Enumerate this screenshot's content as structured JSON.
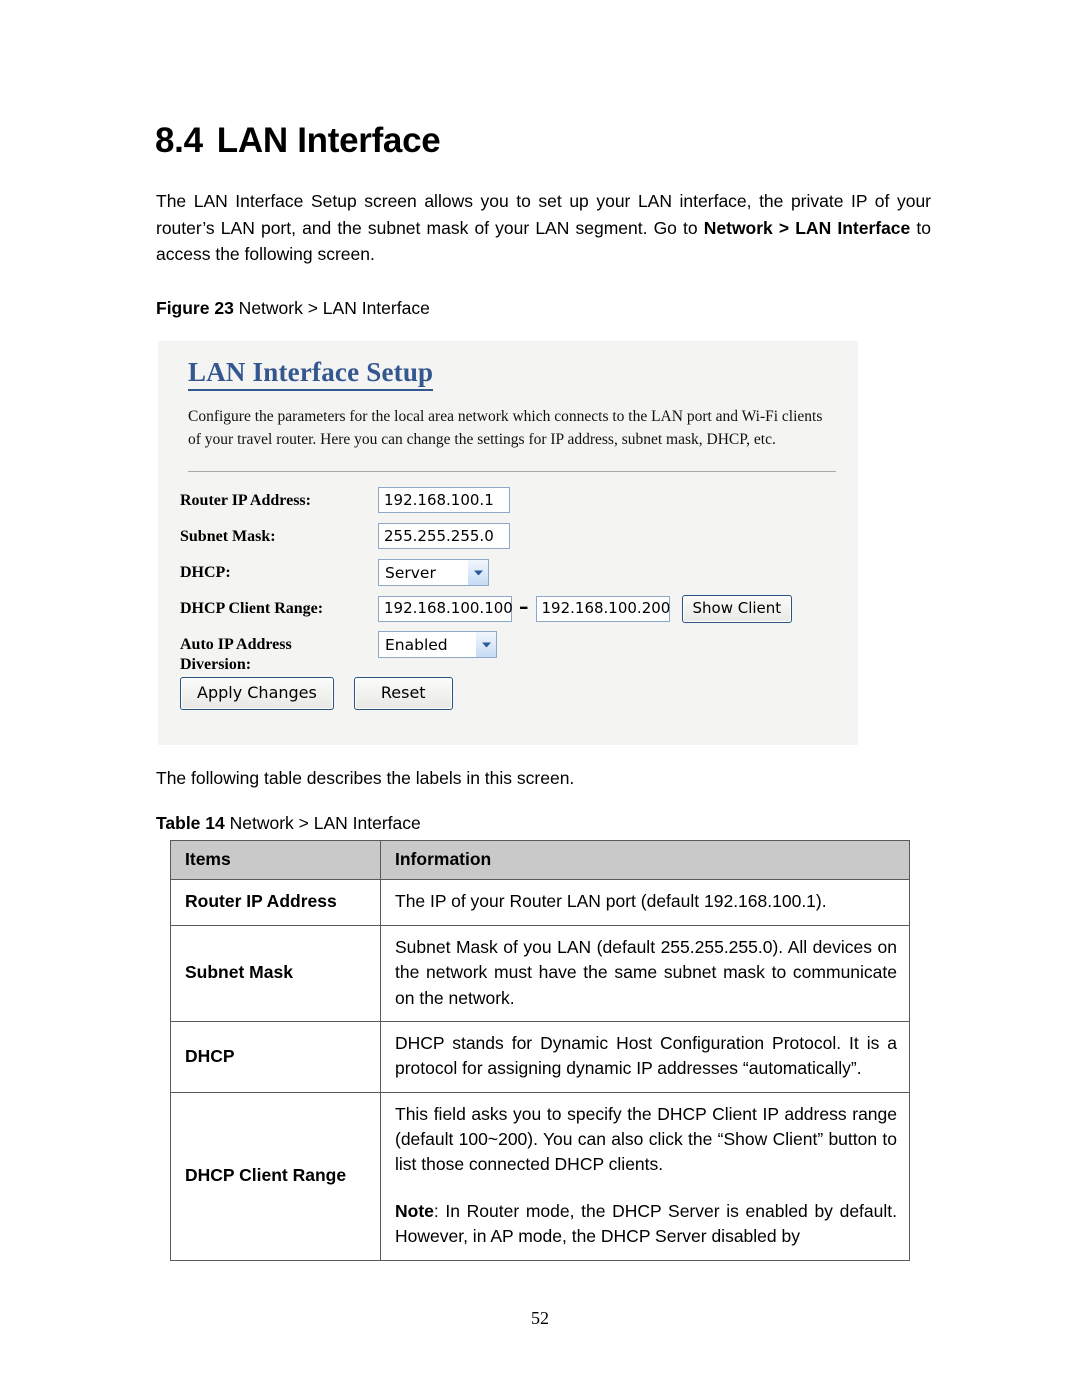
{
  "section": {
    "number": "8.4",
    "title": "LAN Interface"
  },
  "intro": {
    "part1": "The LAN Interface Setup screen allows you to set up your LAN interface, the private IP of your router’s LAN port, and the subnet mask of your LAN segment. Go to ",
    "bold1": "Network > LAN Interface",
    "part2": " to access the following screen."
  },
  "figure": {
    "label": "Figure 23",
    "caption": " Network > LAN Interface"
  },
  "screenshot": {
    "title": "LAN Interface Setup",
    "description": "Configure the parameters for the local area network which connects to the LAN port and Wi-Fi clients of your travel router. Here you can change the settings for IP address, subnet mask, DHCP, etc.",
    "fields": {
      "router_ip_label": "Router IP Address:",
      "router_ip_value": "192.168.100.1",
      "subnet_label": "Subnet Mask:",
      "subnet_value": "255.255.255.0",
      "dhcp_label": "DHCP:",
      "dhcp_value": "Server",
      "dhcp_range_label": "DHCP Client Range:",
      "dhcp_range_start": "192.168.100.100",
      "dhcp_range_dash": "–",
      "dhcp_range_end": "192.168.100.200",
      "show_client_label": "Show Client",
      "auto_ip_label_line1": "Auto IP Address",
      "auto_ip_label_line2": "Diversion:",
      "auto_ip_value": "Enabled"
    },
    "buttons": {
      "apply": "Apply Changes",
      "reset": "Reset"
    },
    "colors": {
      "title_blue": "#34578f",
      "panel_bg": "#f4f4f2",
      "input_border": "#8fa8c8",
      "button_border": "#2a5380"
    }
  },
  "following_line": "The following table describes the labels in this screen.",
  "table": {
    "label": "Table 14",
    "caption": " Network > LAN Interface",
    "headers": [
      "Items",
      "Information"
    ],
    "rows": [
      {
        "item": "Router IP Address",
        "info": [
          "The IP of your Router LAN port (default 192.168.100.1)."
        ]
      },
      {
        "item": "Subnet Mask",
        "info": [
          "Subnet Mask of you LAN (default 255.255.255.0). All devices on the network must have the same subnet mask to communicate on the network."
        ]
      },
      {
        "item": "DHCP",
        "info": [
          "DHCP stands for Dynamic Host Configuration Protocol. It is a protocol for assigning dynamic IP addresses “automatically”."
        ]
      },
      {
        "item": "DHCP Client Range",
        "info": [
          "This field asks you to specify the DHCP Client IP address range (default 100~200). You can also click the “Show Client” button to list those connected DHCP clients.",
          "Note: In Router mode, the DHCP Server is enabled by default. However, in AP mode, the DHCP Server disabled by"
        ],
        "note_prefix": "Note"
      }
    ]
  },
  "page_number": "52"
}
